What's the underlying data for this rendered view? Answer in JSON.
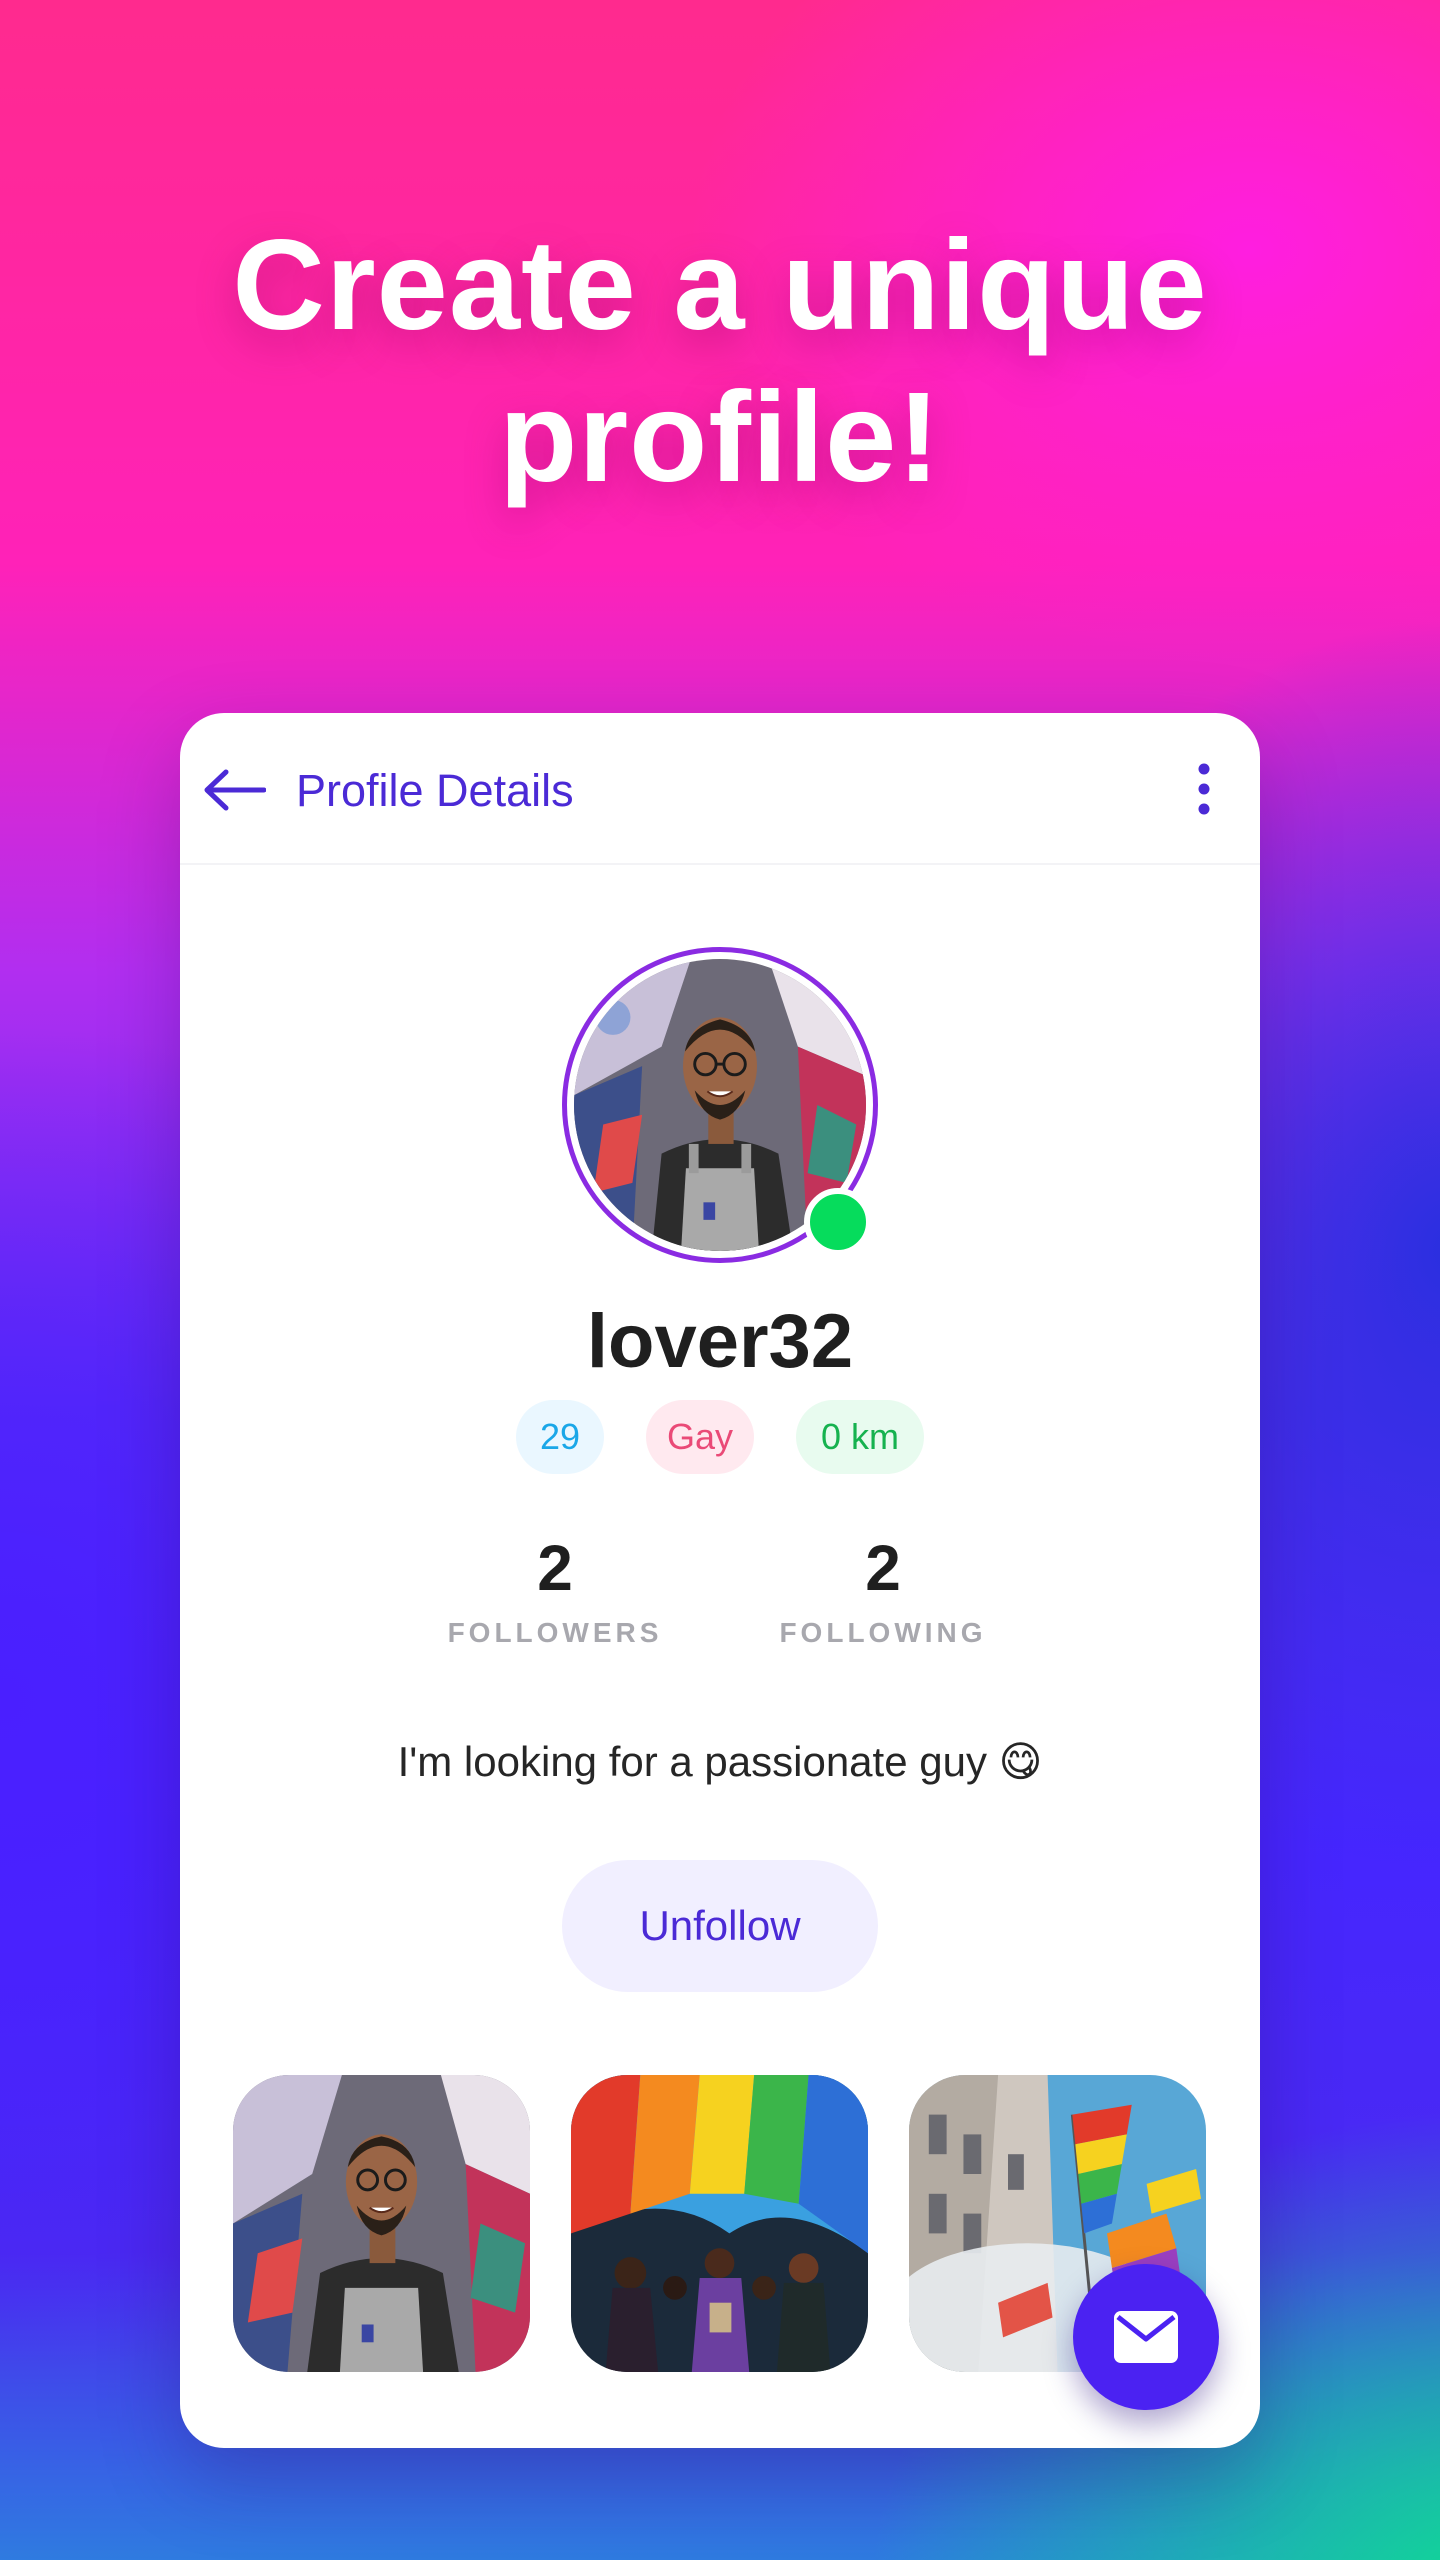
{
  "headline": {
    "line1": "Create a unique",
    "line2": "profile!"
  },
  "topbar": {
    "back_icon": "arrow-left-icon",
    "title": "Profile Details",
    "more_icon": "more-vertical-icon"
  },
  "profile": {
    "username": "lover32",
    "online": true,
    "chips": {
      "age": "29",
      "orientation": "Gay",
      "distance": "0 km"
    },
    "stats": {
      "followers_count": "2",
      "followers_label": "FOLLOWERS",
      "following_count": "2",
      "following_label": "FOLLOWING"
    },
    "bio": "I'm looking for a passionate guy 😋",
    "unfollow_label": "Unfollow"
  },
  "fab": {
    "icon": "mail-icon"
  },
  "colors": {
    "accent": "#4b2ad6",
    "online": "#06dc5c",
    "avatar_ring": "#8a2be2",
    "chip_age": "#1aa7e8",
    "chip_orientation": "#ea4a77",
    "chip_distance": "#16b24f"
  }
}
